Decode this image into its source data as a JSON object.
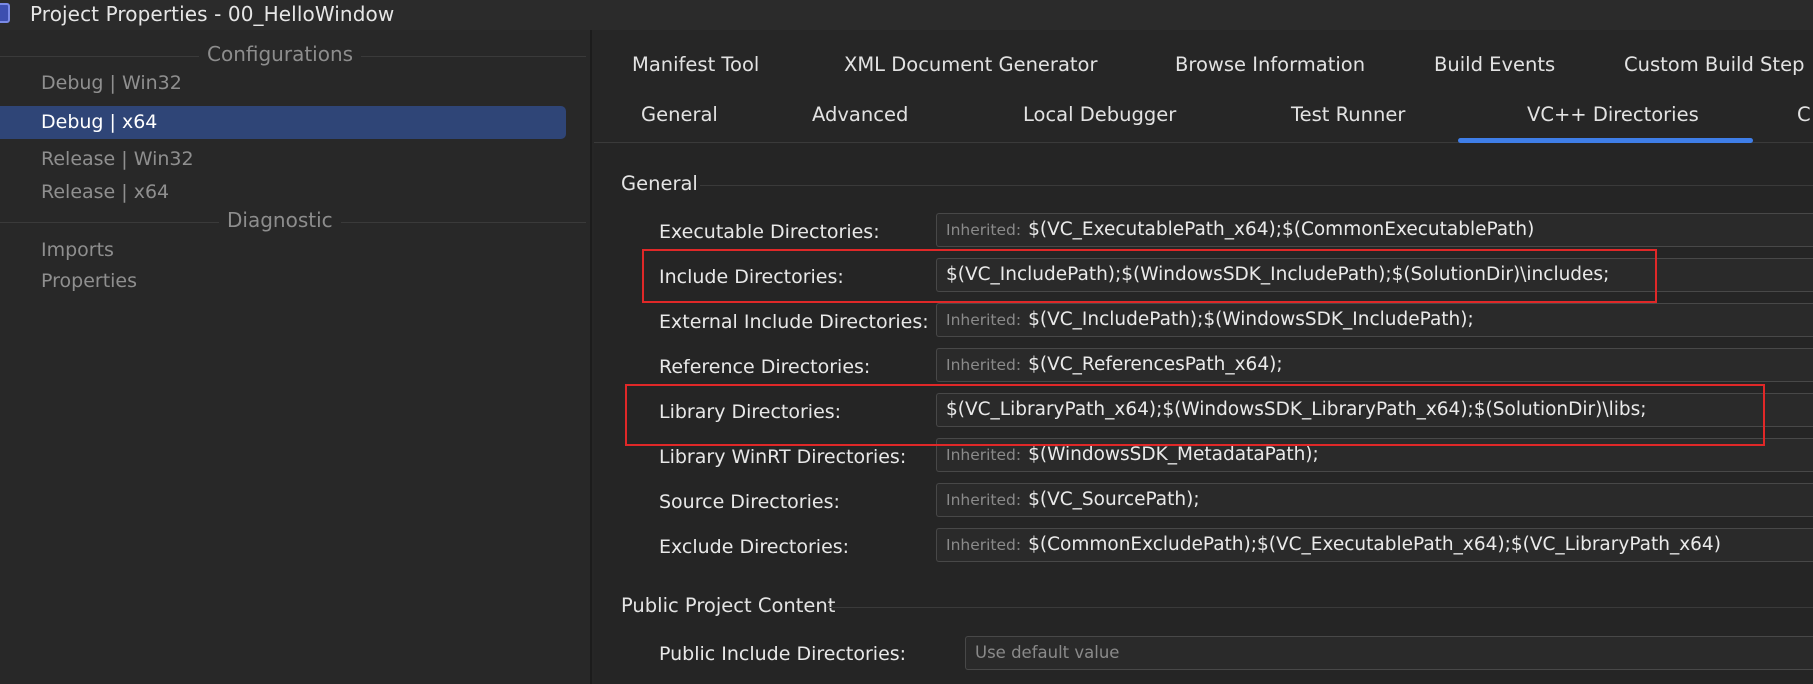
{
  "window": {
    "title": "Project Properties - 00_HelloWindow"
  },
  "sidebar": {
    "sections": [
      {
        "title": "Configurations",
        "items": [
          "Debug | Win32",
          "Debug | x64",
          "Release | Win32",
          "Release | x64"
        ]
      },
      {
        "title": "Diagnostic",
        "items": [
          "Imports",
          "Properties"
        ]
      }
    ],
    "selected": "Debug | x64"
  },
  "tabs": {
    "row1": [
      "Manifest Tool",
      "XML Document Generator",
      "Browse Information",
      "Build Events",
      "Custom Build Step"
    ],
    "row2": [
      "General",
      "Advanced",
      "Local Debugger",
      "Test Runner",
      "VC++ Directories",
      "C"
    ],
    "active": "VC++ Directories"
  },
  "groups": {
    "general": {
      "title": "General",
      "properties": [
        {
          "label": "Executable Directories:",
          "inherited": "Inherited:",
          "value": "$(VC_ExecutablePath_x64);$(CommonExecutablePath)"
        },
        {
          "label": "Include Directories:",
          "inherited": "",
          "value": "$(VC_IncludePath);$(WindowsSDK_IncludePath);$(SolutionDir)\\includes;"
        },
        {
          "label": "External Include Directories:",
          "inherited": "Inherited:",
          "value": "$(VC_IncludePath);$(WindowsSDK_IncludePath);"
        },
        {
          "label": "Reference Directories:",
          "inherited": "Inherited:",
          "value": "$(VC_ReferencesPath_x64);"
        },
        {
          "label": "Library Directories:",
          "inherited": "",
          "value": "$(VC_LibraryPath_x64);$(WindowsSDK_LibraryPath_x64);$(SolutionDir)\\libs;"
        },
        {
          "label": "Library WinRT Directories:",
          "inherited": "Inherited:",
          "value": "$(WindowsSDK_MetadataPath);"
        },
        {
          "label": "Source Directories:",
          "inherited": "Inherited:",
          "value": "$(VC_SourcePath);"
        },
        {
          "label": "Exclude Directories:",
          "inherited": "Inherited:",
          "value": "$(CommonExcludePath);$(VC_ExecutablePath_x64);$(VC_LibraryPath_x64)"
        }
      ]
    },
    "public": {
      "title": "Public Project Content",
      "properties": [
        {
          "label": "Public Include Directories:",
          "placeholder": "Use default value"
        }
      ]
    }
  },
  "colors": {
    "accent": "#3f7ee8",
    "selection": "#2f4577",
    "highlight": "#e02828"
  }
}
